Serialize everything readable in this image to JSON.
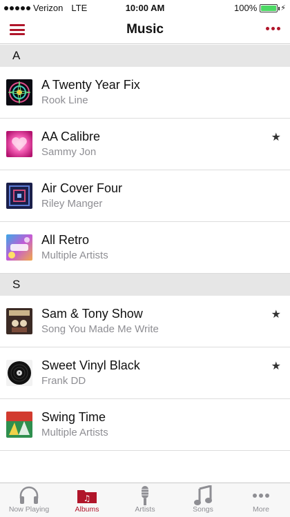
{
  "status": {
    "carrier": "Verizon",
    "network": "LTE",
    "time": "10:00 AM",
    "battery": "100%",
    "battery_level": 1.0
  },
  "nav": {
    "title": "Music"
  },
  "sections": [
    {
      "letter": "A",
      "albums": [
        {
          "title": "A Twenty Year Fix",
          "artist": "Rook Line",
          "starred": false
        },
        {
          "title": "AA Calibre",
          "artist": "Sammy Jon",
          "starred": true
        },
        {
          "title": "Air Cover Four",
          "artist": "Riley Manger",
          "starred": false
        },
        {
          "title": "All Retro",
          "artist": "Multiple Artists",
          "starred": false
        }
      ]
    },
    {
      "letter": "S",
      "albums": [
        {
          "title": "Sam & Tony Show",
          "artist": "Song You Made Me Write",
          "starred": true
        },
        {
          "title": "Sweet Vinyl Black",
          "artist": "Frank DD",
          "starred": true
        },
        {
          "title": "Swing Time",
          "artist": "Multiple Artists",
          "starred": false
        }
      ]
    }
  ],
  "star_glyph": "★",
  "tabs": [
    {
      "label": "Now Playing",
      "icon": "headphones-icon",
      "active": false
    },
    {
      "label": "Albums",
      "icon": "albums-folder-icon",
      "active": true
    },
    {
      "label": "Artists",
      "icon": "microphone-icon",
      "active": false
    },
    {
      "label": "Songs",
      "icon": "music-note-icon",
      "active": false
    },
    {
      "label": "More",
      "icon": "more-dots-icon",
      "active": false
    }
  ],
  "colors": {
    "accent": "#b0152a",
    "inactive": "#8e8e93",
    "battery": "#4cd964"
  }
}
